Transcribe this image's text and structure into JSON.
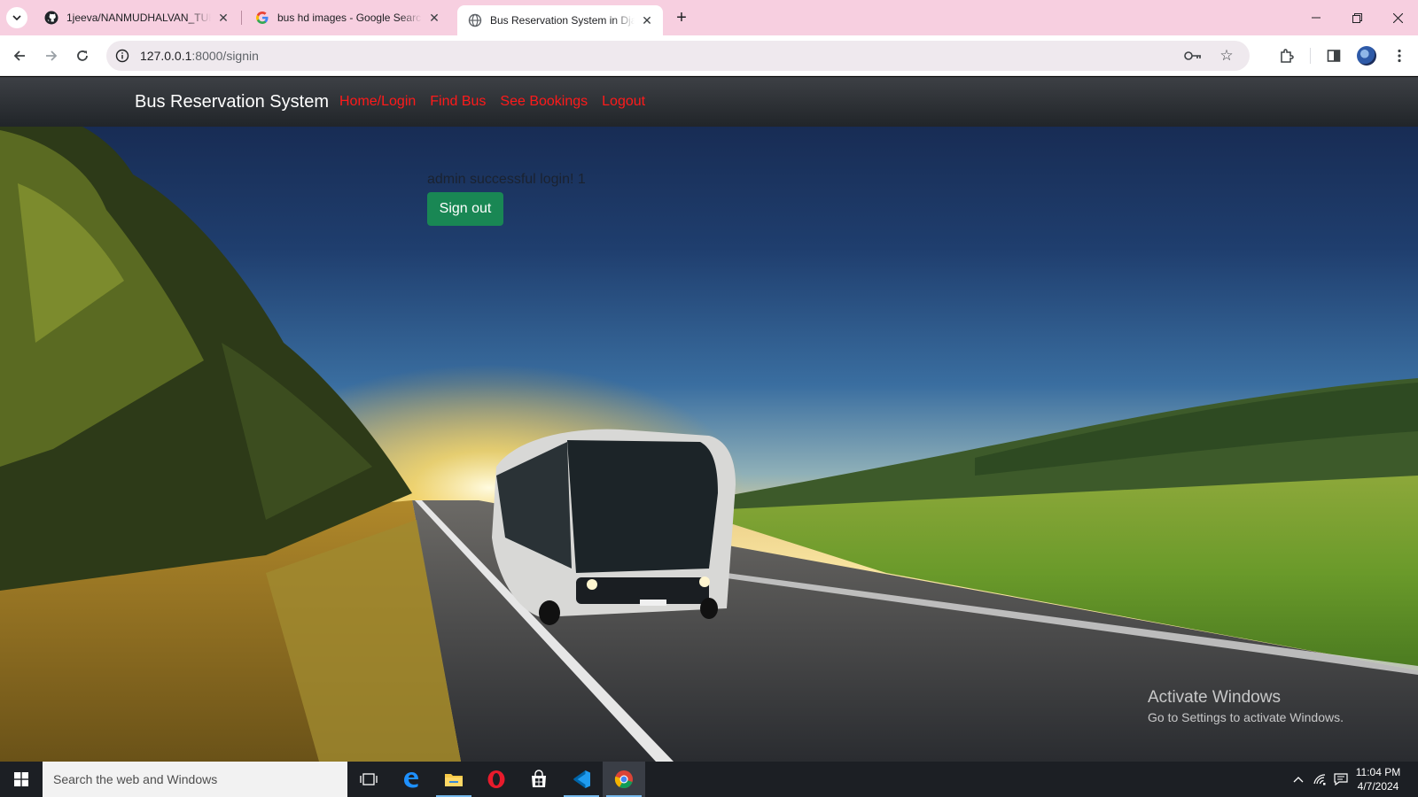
{
  "browser": {
    "tabs": [
      {
        "title": "1jeeva/NANMUDHALVAN_TUES",
        "favicon": "github-icon",
        "active": false
      },
      {
        "title": "bus hd images - Google Search",
        "favicon": "google-icon",
        "active": false
      },
      {
        "title": "Bus Reservation System in Djan",
        "favicon": "globe-icon",
        "active": true
      }
    ],
    "address": {
      "host": "127.0.0.1",
      "rest": ":8000/signin"
    }
  },
  "page": {
    "brand": "Bus Reservation System",
    "nav": [
      "Home/Login",
      "Find Bus",
      "See Bookings",
      "Logout"
    ],
    "message": "admin successful login! 1",
    "signout_label": "Sign out",
    "watermark": {
      "line1": "Activate Windows",
      "line2": "Go to Settings to activate Windows."
    },
    "colors": {
      "nav_link": "#ff1a1a",
      "button": "#198754",
      "navbar": "#212529"
    }
  },
  "taskbar": {
    "search_placeholder": "Search the web and Windows",
    "time": "11:04 PM",
    "date": "4/7/2024"
  }
}
